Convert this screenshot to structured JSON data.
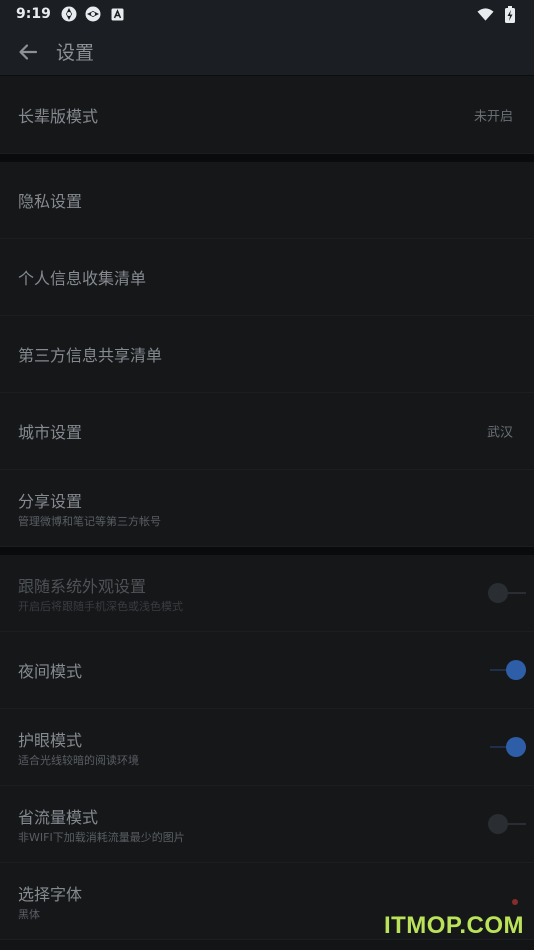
{
  "status_bar": {
    "time": "9:19"
  },
  "app_bar": {
    "title": "设置"
  },
  "rows": {
    "elder_mode": {
      "label": "长辈版模式",
      "value": "未开启"
    },
    "privacy": {
      "label": "隐私设置"
    },
    "personal_info": {
      "label": "个人信息收集清单"
    },
    "third_party": {
      "label": "第三方信息共享清单"
    },
    "city": {
      "label": "城市设置",
      "value": "武汉"
    },
    "share": {
      "label": "分享设置",
      "sub": "管理微博和笔记等第三方帐号"
    },
    "follow_system": {
      "label": "跟随系统外观设置",
      "sub": "开启后将跟随手机深色或浅色模式",
      "toggle_on": false
    },
    "night_mode": {
      "label": "夜间模式",
      "toggle_on": true
    },
    "eye_care": {
      "label": "护眼模式",
      "sub": "适合光线较暗的阅读环境",
      "toggle_on": true
    },
    "data_saver": {
      "label": "省流量模式",
      "sub": "非WIFI下加载消耗流量最少的图片",
      "toggle_on": false
    },
    "font": {
      "label": "选择字体",
      "sub": "黑体"
    }
  },
  "watermark": "ITMOP.COM",
  "colors": {
    "toggle_on": "#2f5ea8",
    "background": "#151719",
    "watermark": "#bbe35a"
  }
}
